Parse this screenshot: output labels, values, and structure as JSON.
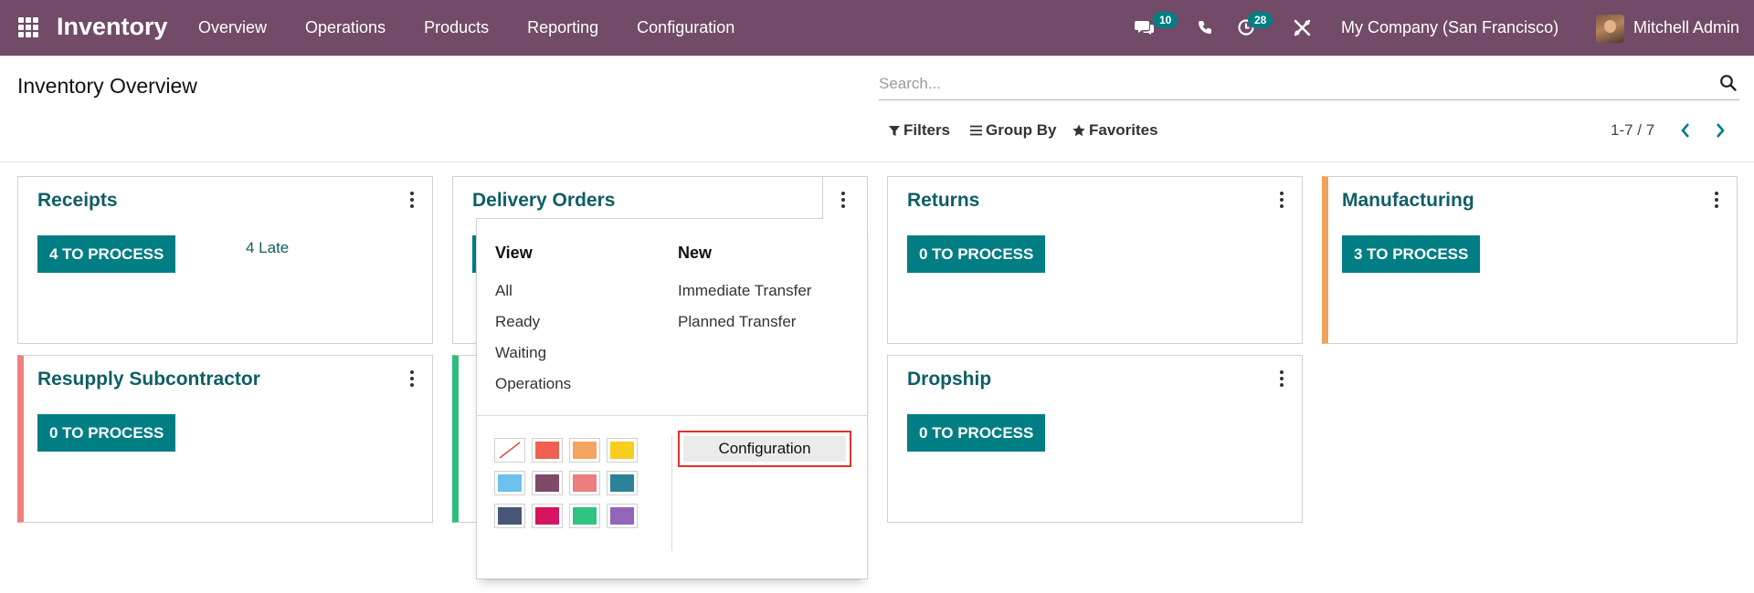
{
  "app": {
    "name": "Inventory"
  },
  "nav": {
    "menu": [
      "Overview",
      "Operations",
      "Products",
      "Reporting",
      "Configuration"
    ],
    "messages_count": "10",
    "activities_count": "28",
    "company": "My Company (San Francisco)",
    "user": "Mitchell Admin"
  },
  "control": {
    "title": "Inventory Overview",
    "search_placeholder": "Search...",
    "filters": "Filters",
    "group_by": "Group By",
    "favorites": "Favorites",
    "pager": "1-7 / 7"
  },
  "cards": [
    {
      "title": "Receipts",
      "button": "4 TO PROCESS",
      "late": "4 Late",
      "accent": ""
    },
    {
      "title": "Delivery Orders",
      "button": "",
      "late": "",
      "accent": ""
    },
    {
      "title": "Returns",
      "button": "0 TO PROCESS",
      "late": "",
      "accent": ""
    },
    {
      "title": "Manufacturing",
      "button": "3 TO PROCESS",
      "late": "",
      "accent": "#f0a35e"
    },
    {
      "title": "Resupply Subcontractor",
      "button": "0 TO PROCESS",
      "late": "",
      "accent": "#f08080"
    },
    {
      "title": "",
      "button": "",
      "late": "",
      "accent": "#2ebd7f"
    },
    {
      "title": "Dropship",
      "button": "0 TO PROCESS",
      "late": "",
      "accent": ""
    }
  ],
  "dropdown": {
    "view_heading": "View",
    "view_items": [
      "All",
      "Ready",
      "Waiting",
      "Operations"
    ],
    "new_heading": "New",
    "new_items": [
      "Immediate Transfer",
      "Planned Transfer"
    ],
    "config_button": "Configuration",
    "colors": [
      [
        "none",
        "#f06050",
        "#f4a460",
        "#f7cd1f"
      ],
      [
        "#6cc1ed",
        "#814968",
        "#eb7e7f",
        "#2c8397"
      ],
      [
        "#475577",
        "#d6145f",
        "#30c381",
        "#9365b8"
      ]
    ]
  },
  "colors": {
    "brand": "#714b67",
    "primary": "#017e84",
    "title_teal": "#0f5e63",
    "highlight": "#e0332b"
  }
}
